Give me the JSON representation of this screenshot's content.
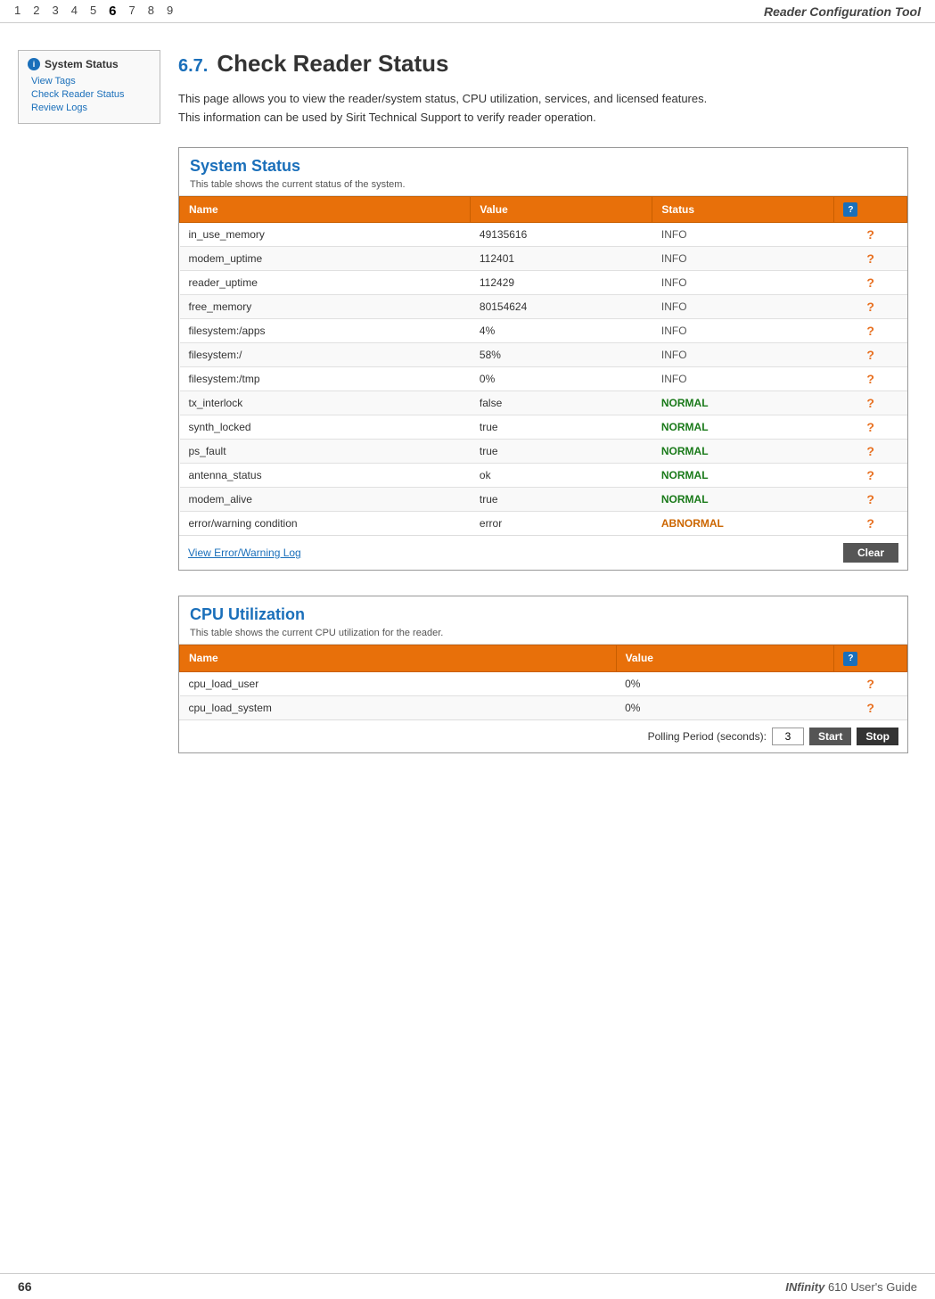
{
  "header": {
    "nav_items": [
      {
        "label": "1",
        "active": false
      },
      {
        "label": "2",
        "active": false
      },
      {
        "label": "3",
        "active": false
      },
      {
        "label": "4",
        "active": false
      },
      {
        "label": "5",
        "active": false
      },
      {
        "label": "6",
        "active": true
      },
      {
        "label": "7",
        "active": false
      },
      {
        "label": "8",
        "active": false
      },
      {
        "label": "9",
        "active": false
      }
    ],
    "title": "Reader Configuration Tool"
  },
  "sidebar": {
    "title": "System Status",
    "icon_label": "i",
    "links": [
      {
        "label": "View Tags"
      },
      {
        "label": "Check Reader Status"
      },
      {
        "label": "Review Logs"
      }
    ]
  },
  "section": {
    "number": "6.7.",
    "title": "Check Reader Status",
    "description": "This page allows you to view the reader/system status, CPU utilization, services, and licensed features. This information can be used by Sirit Technical Support to verify reader operation."
  },
  "system_status_table": {
    "title": "System Status",
    "description": "This table shows the current status of the system.",
    "columns": [
      "Name",
      "Value",
      "Status",
      "?"
    ],
    "rows": [
      {
        "name": "in_use_memory",
        "value": "49135616",
        "status": "INFO",
        "status_type": "info"
      },
      {
        "name": "modem_uptime",
        "value": "112401",
        "status": "INFO",
        "status_type": "info"
      },
      {
        "name": "reader_uptime",
        "value": "112429",
        "status": "INFO",
        "status_type": "info"
      },
      {
        "name": "free_memory",
        "value": "80154624",
        "status": "INFO",
        "status_type": "info"
      },
      {
        "name": "filesystem:/apps",
        "value": "4%",
        "status": "INFO",
        "status_type": "info"
      },
      {
        "name": "filesystem:/",
        "value": "58%",
        "status": "INFO",
        "status_type": "info"
      },
      {
        "name": "filesystem:/tmp",
        "value": "0%",
        "status": "INFO",
        "status_type": "info"
      },
      {
        "name": "tx_interlock",
        "value": "false",
        "status": "NORMAL",
        "status_type": "normal"
      },
      {
        "name": "synth_locked",
        "value": "true",
        "status": "NORMAL",
        "status_type": "normal"
      },
      {
        "name": "ps_fault",
        "value": "true",
        "status": "NORMAL",
        "status_type": "normal"
      },
      {
        "name": "antenna_status",
        "value": "ok",
        "status": "NORMAL",
        "status_type": "normal"
      },
      {
        "name": "modem_alive",
        "value": "true",
        "status": "NORMAL",
        "status_type": "normal"
      },
      {
        "name": "error/warning condition",
        "value": "error",
        "status": "ABNORMAL",
        "status_type": "abnormal"
      }
    ],
    "footer": {
      "view_log_label": "View Error/Warning Log",
      "clear_button": "Clear"
    }
  },
  "cpu_table": {
    "title": "CPU Utilization",
    "description": "This table shows the current CPU utilization for the reader.",
    "columns": [
      "Name",
      "Value",
      "?"
    ],
    "rows": [
      {
        "name": "cpu_load_user",
        "value": "0%"
      },
      {
        "name": "cpu_load_system",
        "value": "0%"
      }
    ],
    "footer": {
      "polling_label": "Polling Period (seconds):",
      "polling_value": "3",
      "start_button": "Start",
      "stop_button": "Stop"
    }
  },
  "footer": {
    "page_number": "66",
    "brand": "INfinity 610 User's Guide"
  }
}
